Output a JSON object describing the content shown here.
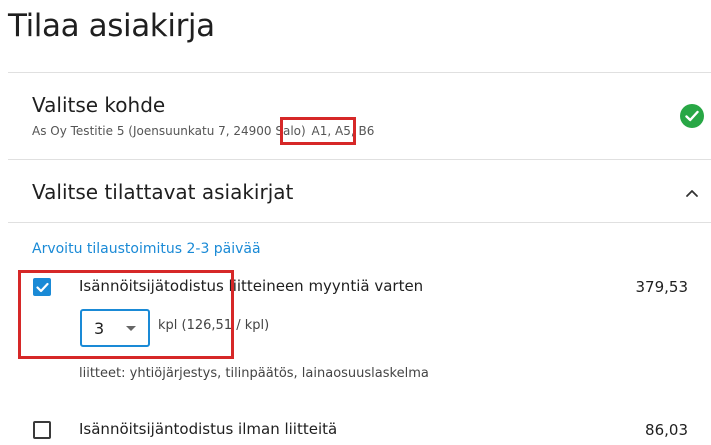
{
  "page": {
    "title": "Tilaa asiakirja"
  },
  "target_section": {
    "title": "Valitse kohde",
    "address": "As Oy Testitie 5 (Joensuunkatu 7, 24900 Salo)",
    "apartments": "A1, A5, B6",
    "status_icon": "check-circle-icon",
    "status_color": "#28a745"
  },
  "documents_section": {
    "title": "Valitse tilattavat asiakirjat",
    "toggle_icon": "chevron-up-icon",
    "delivery_estimate": "Arvoitu tilaustoimitus 2-3 päivää",
    "items": [
      {
        "name": "Isännöitsijätodistus liitteineen myyntiä varten",
        "price": "379,53",
        "checked": true,
        "quantity": "3",
        "unit_price": "kpl (126,51 / kpl)",
        "attachments": "liitteet: yhtiöjärjestys, tilinpäätös, lainaosuuslaskelma"
      },
      {
        "name": "Isännöitsijäntodistus ilman liitteitä",
        "price": "86,03",
        "checked": false
      }
    ]
  },
  "colors": {
    "accent": "#1a8ad6",
    "highlight": "#d62828"
  }
}
